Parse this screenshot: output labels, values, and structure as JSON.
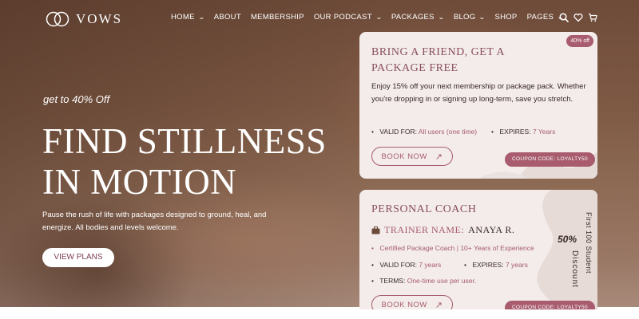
{
  "brand": {
    "name": "VOWS"
  },
  "nav": {
    "items": [
      {
        "label": "HOME",
        "dropdown": true
      },
      {
        "label": "ABOUT",
        "dropdown": false
      },
      {
        "label": "MEMBERSHIP",
        "dropdown": false
      },
      {
        "label": "OUR PODCAST",
        "dropdown": true
      },
      {
        "label": "PACKAGES",
        "dropdown": true
      },
      {
        "label": "BLOG",
        "dropdown": true
      },
      {
        "label": "SHOP",
        "dropdown": false
      },
      {
        "label": "PAGES",
        "dropdown": true
      }
    ],
    "chevron": "⌄",
    "icons": [
      "search-icon",
      "heart-icon",
      "cart-icon"
    ]
  },
  "hero": {
    "kicker": "get to 40% Off",
    "headline_line1": "FIND STILLNESS",
    "headline_line2": "IN MOTION",
    "subtext": "Pause the rush of life with packages designed to ground, heal, and energize. All bodies and levels welcome.",
    "cta_label": "VIEW PLANS"
  },
  "card1": {
    "title_line1": "BRING A FRIEND, GET A",
    "title_line2": "PACKAGE FREE",
    "badge": "40% off",
    "description": "Enjoy 15% off your next membership or package pack. Whether you're dropping in or signing up long-term, save you stretch.",
    "valid_label": "VALID FOR:",
    "valid_value": "All users (one time)",
    "expires_label": "EXPIRES:",
    "expires_value": "7 Years",
    "book_label": "BOOK NOW",
    "coupon": "COUPON CODE: LOYALTY50"
  },
  "card2": {
    "title": "PERSONAL COACH",
    "trainer_label": "TRAINER NAME:",
    "trainer_name": "ANAYA R.",
    "certification": "Certified Package Coach | 10+ Years of Experience",
    "valid_label": "VALID FOR:",
    "valid_value": "7 years",
    "expires_label": "EXPIRES:",
    "expires_value": "7 years",
    "terms_label": "TERMS:",
    "terms_value": "One-time use per user.",
    "book_label": "BOOK NOW",
    "coupon": "COUPON CODE: LOYALTY50",
    "side_percent": "50%",
    "side_text1": "First 100 Student",
    "side_text2": "Discount"
  },
  "colors": {
    "accent": "#a85c6e",
    "card_bg": "#f3ecea",
    "hero_bg": "#7e5a45"
  }
}
